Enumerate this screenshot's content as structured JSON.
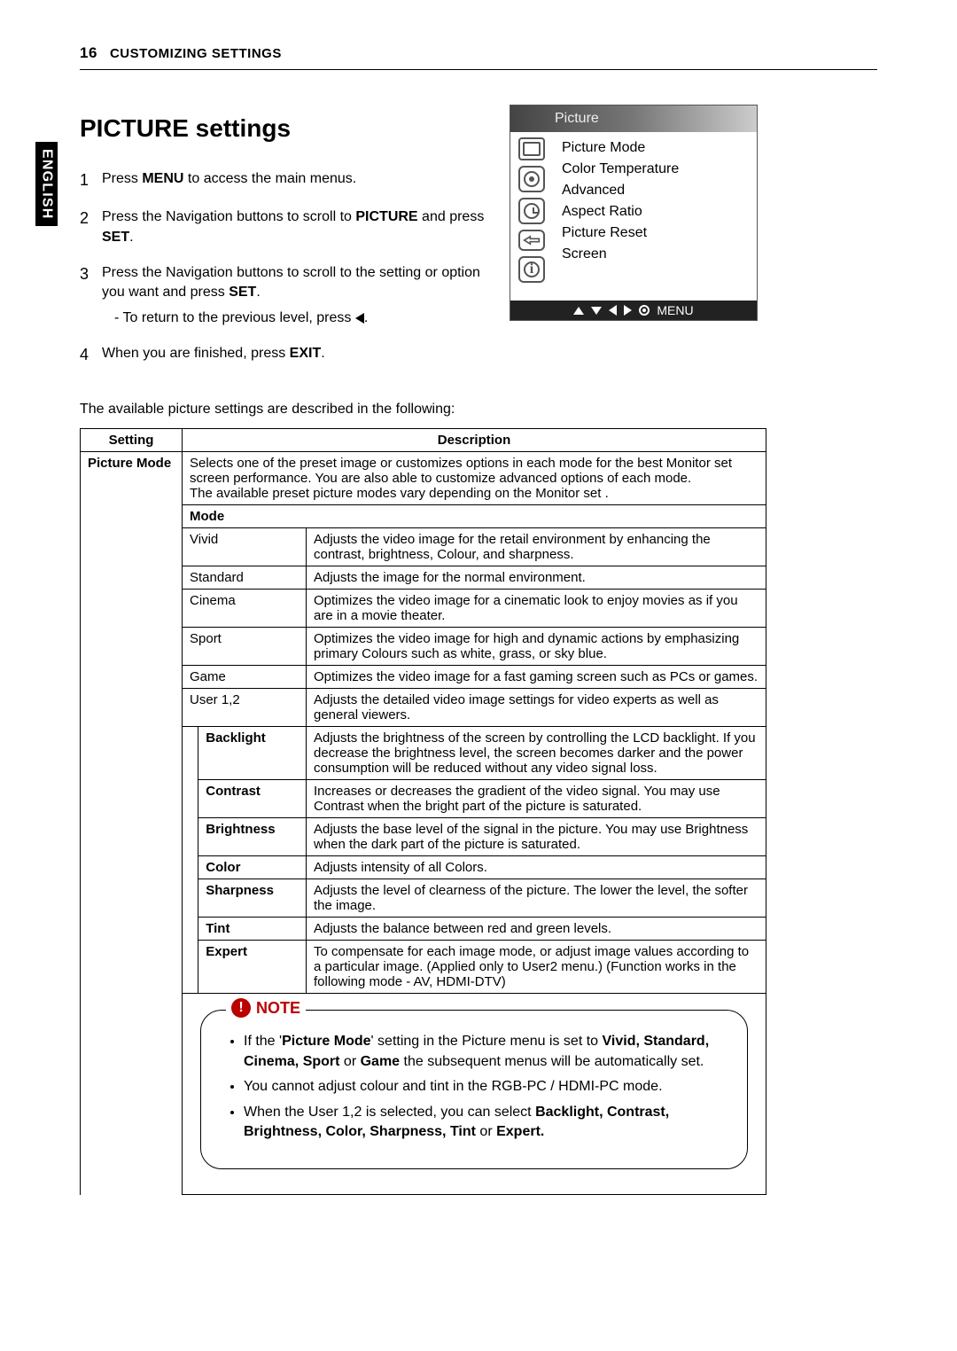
{
  "header": {
    "page_number": "16",
    "section": "CUSTOMIZING SETTINGS"
  },
  "side_tab": "ENGLISH",
  "title": "PICTURE settings",
  "steps": {
    "s1": {
      "num": "1",
      "pre": "Press ",
      "bold": "MENU",
      "post": " to access the main menus."
    },
    "s2": {
      "num": "2",
      "pre": "Press the Navigation buttons to scroll to ",
      "bold1": "PICTURE",
      "mid": " and press ",
      "bold2": "SET",
      "post": "."
    },
    "s3": {
      "num": "3",
      "pre": "Press the Navigation buttons to scroll to the setting or option you want and press ",
      "bold": "SET",
      "post": ".",
      "sub": "- To return to the previous level, press "
    },
    "s4": {
      "num": "4",
      "pre": "When you are finished, press ",
      "bold": "EXIT",
      "post": "."
    }
  },
  "osd": {
    "title": "Picture",
    "items": [
      "Picture Mode",
      "Color Temperature",
      "Advanced",
      "Aspect Ratio",
      "Picture Reset",
      "Screen"
    ],
    "menu_label": "MENU"
  },
  "intro": "The available picture settings are described in the following:",
  "table": {
    "h_setting": "Setting",
    "h_desc": "Description",
    "picture_mode_label": "Picture Mode",
    "picture_mode_desc": "Selects one of the preset image or customizes options in each mode for the best Monitor set screen performance. You are also able to customize advanced options of each mode.\nThe available preset picture modes vary depending on the Monitor set .",
    "mode_header": "Mode",
    "modes": [
      {
        "name": "Vivid",
        "desc": "Adjusts the video image for the retail environment by enhancing the contrast, brightness, Colour, and sharpness."
      },
      {
        "name": "Standard",
        "desc": "Adjusts the image for the normal environment."
      },
      {
        "name": "Cinema",
        "desc": "Optimizes the video image for a cinematic look to enjoy movies as if you are in a movie theater."
      },
      {
        "name": "Sport",
        "desc": "Optimizes the video image for high and dynamic actions by emphasizing primary Colours such as white, grass, or sky blue."
      },
      {
        "name": "Game",
        "desc": "Optimizes the video image for a fast gaming screen such as PCs or games."
      },
      {
        "name": "User 1,2",
        "desc": "Adjusts the detailed video image settings for video experts as well as general viewers."
      }
    ],
    "subs": [
      {
        "name": "Backlight",
        "desc": "Adjusts the brightness of the screen by controlling the LCD backlight. If you decrease the brightness level, the screen becomes darker and the power consumption will be reduced without any video signal loss."
      },
      {
        "name": "Contrast",
        "desc": "Increases or decreases the gradient of the video signal. You may use Contrast when the bright part of the picture is saturated."
      },
      {
        "name": "Brightness",
        "desc": "Adjusts the base level of the signal in the picture. You may use Brightness when the dark part of the picture is saturated."
      },
      {
        "name": "Color",
        "desc": "Adjusts intensity of all Colors."
      },
      {
        "name": "Sharpness",
        "desc": "Adjusts the level of clearness of the picture. The lower the level, the softer the image."
      },
      {
        "name": "Tint",
        "desc": "Adjusts the balance between red and green levels."
      },
      {
        "name": "Expert",
        "desc": "To compensate for each image mode, or adjust image values according to a particular image. (Applied only to User2 menu.) (Function works in the following mode - AV, HDMI-DTV)"
      }
    ]
  },
  "note": {
    "label": "NOTE",
    "li1": {
      "a": "If the '",
      "b": "Picture Mode",
      "c": "' setting in the Picture menu is set to ",
      "d": "Vivid, Standard, Cinema, Sport",
      "e": " or ",
      "f": "Game",
      "g": " the subsequent menus will be automatically set."
    },
    "li2": "You cannot adjust colour and tint in the RGB-PC / HDMI-PC mode.",
    "li3": {
      "a": "When the User 1,2 is selected, you can select ",
      "b": "Backlight, Contrast, Brightness, Color, Sharpness, Tint ",
      "c": "or",
      "d": " Expert."
    }
  }
}
